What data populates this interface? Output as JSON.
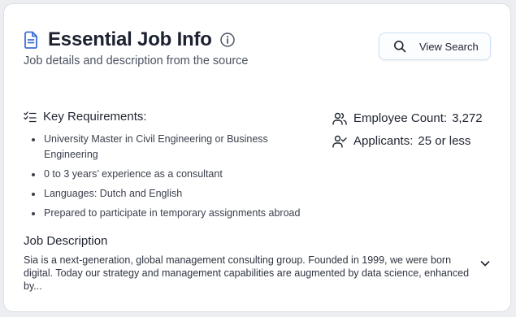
{
  "header": {
    "title": "Essential Job Info",
    "subtitle": "Job details and description from the source",
    "title_icon": "document-icon",
    "info_icon": "info-circle-icon"
  },
  "view_search": {
    "label": "View Search",
    "icon": "search-icon"
  },
  "requirements": {
    "title": "Key Requirements:",
    "icon": "list-check-icon",
    "items": [
      "University Master in Civil Engineering or Business Engineering",
      "0 to 3 years’ experience as a consultant",
      "Languages: Dutch and English",
      "Prepared to participate in temporary assignments abroad"
    ]
  },
  "stats": {
    "employee_count_label": "Employee Count:",
    "employee_count_value": "3,272",
    "applicants_label": "Applicants:",
    "applicants_value": "25 or less",
    "employee_icon": "users-icon",
    "applicants_icon": "user-check-icon"
  },
  "description": {
    "title": "Job Description",
    "text": "Sia is a next-generation, global management consulting group. Founded in 1999, we were born digital. Today our strategy and management capabilities are augmented by data science, enhanced by...",
    "expand_icon": "chevron-down-icon"
  },
  "colors": {
    "accent": "#3b6fd8",
    "button_border": "#cfe0f3",
    "text": "#1f2430"
  }
}
